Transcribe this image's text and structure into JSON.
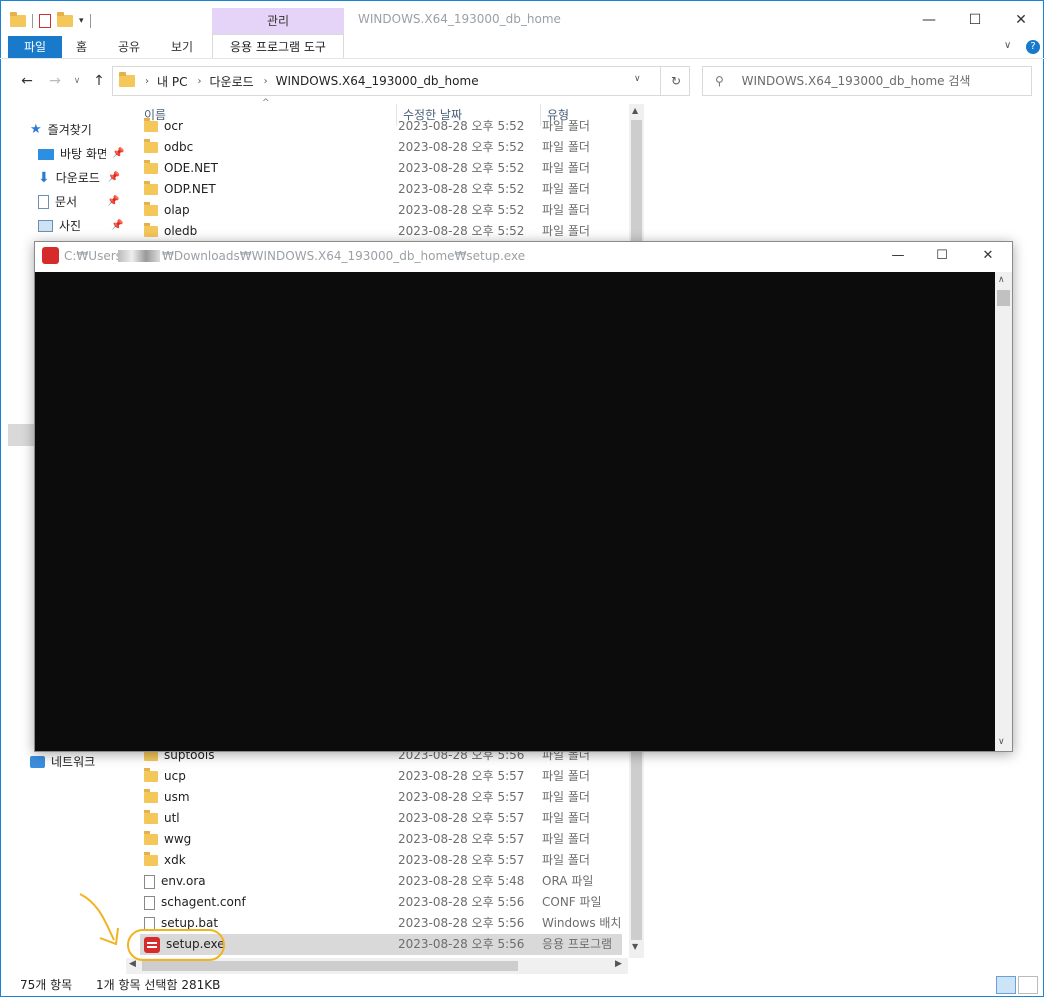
{
  "window": {
    "title": "WINDOWS.X64_193000_db_home",
    "context_tab": "관리",
    "minimize_glyph": "—",
    "maximize_glyph": "☐",
    "close_glyph": "✕"
  },
  "ribbon": {
    "file": "파일",
    "tabs": [
      "홈",
      "공유",
      "보기"
    ],
    "active_tab": "응용 프로그램 도구"
  },
  "address": {
    "crumbs": [
      "내 PC",
      "다운로드",
      "WINDOWS.X64_193000_db_home"
    ],
    "search_placeholder": "WINDOWS.X64_193000_db_home 검색"
  },
  "nav": {
    "quick_access": "즐겨찾기",
    "items": [
      "바탕 화면",
      "다운로드",
      "문서",
      "사진"
    ],
    "network": "네트워크"
  },
  "columns": {
    "name": "이름",
    "date": "수정한 날짜",
    "type": "유형"
  },
  "top_rows": [
    {
      "name": "ocr",
      "date": "2023-08-28 오후 5:52",
      "type": "파일 폴더"
    },
    {
      "name": "odbc",
      "date": "2023-08-28 오후 5:52",
      "type": "파일 폴더"
    },
    {
      "name": "ODE.NET",
      "date": "2023-08-28 오후 5:52",
      "type": "파일 폴더"
    },
    {
      "name": "ODP.NET",
      "date": "2023-08-28 오후 5:52",
      "type": "파일 폴더"
    },
    {
      "name": "olap",
      "date": "2023-08-28 오후 5:52",
      "type": "파일 폴더"
    },
    {
      "name": "oledb",
      "date": "2023-08-28 오후 5:52",
      "type": "파일 폴더"
    }
  ],
  "bottom_rows": [
    {
      "name": "suptools",
      "date": "2023-08-28 오후 5:56",
      "type": "파일 폴더",
      "kind": "folder"
    },
    {
      "name": "ucp",
      "date": "2023-08-28 오후 5:57",
      "type": "파일 폴더",
      "kind": "folder"
    },
    {
      "name": "usm",
      "date": "2023-08-28 오후 5:57",
      "type": "파일 폴더",
      "kind": "folder"
    },
    {
      "name": "utl",
      "date": "2023-08-28 오후 5:57",
      "type": "파일 폴더",
      "kind": "folder"
    },
    {
      "name": "wwg",
      "date": "2023-08-28 오후 5:57",
      "type": "파일 폴더",
      "kind": "folder"
    },
    {
      "name": "xdk",
      "date": "2023-08-28 오후 5:57",
      "type": "파일 폴더",
      "kind": "folder"
    },
    {
      "name": "env.ora",
      "date": "2023-08-28 오후 5:48",
      "type": "ORA 파일",
      "kind": "file"
    },
    {
      "name": "schagent.conf",
      "date": "2023-08-28 오후 5:56",
      "type": "CONF 파일",
      "kind": "file"
    },
    {
      "name": "setup.bat",
      "date": "2023-08-28 오후 5:56",
      "type": "Windows 배치",
      "kind": "file"
    },
    {
      "name": "setup.exe",
      "date": "2023-08-28 오후 5:56",
      "type": "응용 프로그램",
      "kind": "exe"
    }
  ],
  "console": {
    "title_prefix": "C:₩Users₩",
    "title_suffix": "₩Downloads₩WINDOWS.X64_193000_db_home₩setup.exe",
    "minimize_glyph": "—",
    "maximize_glyph": "☐",
    "close_glyph": "✕"
  },
  "status": {
    "count": "75개 항목",
    "selection": "1개 항목 선택함 281KB"
  },
  "colors": {
    "accent": "#1979ca",
    "annotation": "#f2b320",
    "console_bg": "#0c0c0c"
  }
}
